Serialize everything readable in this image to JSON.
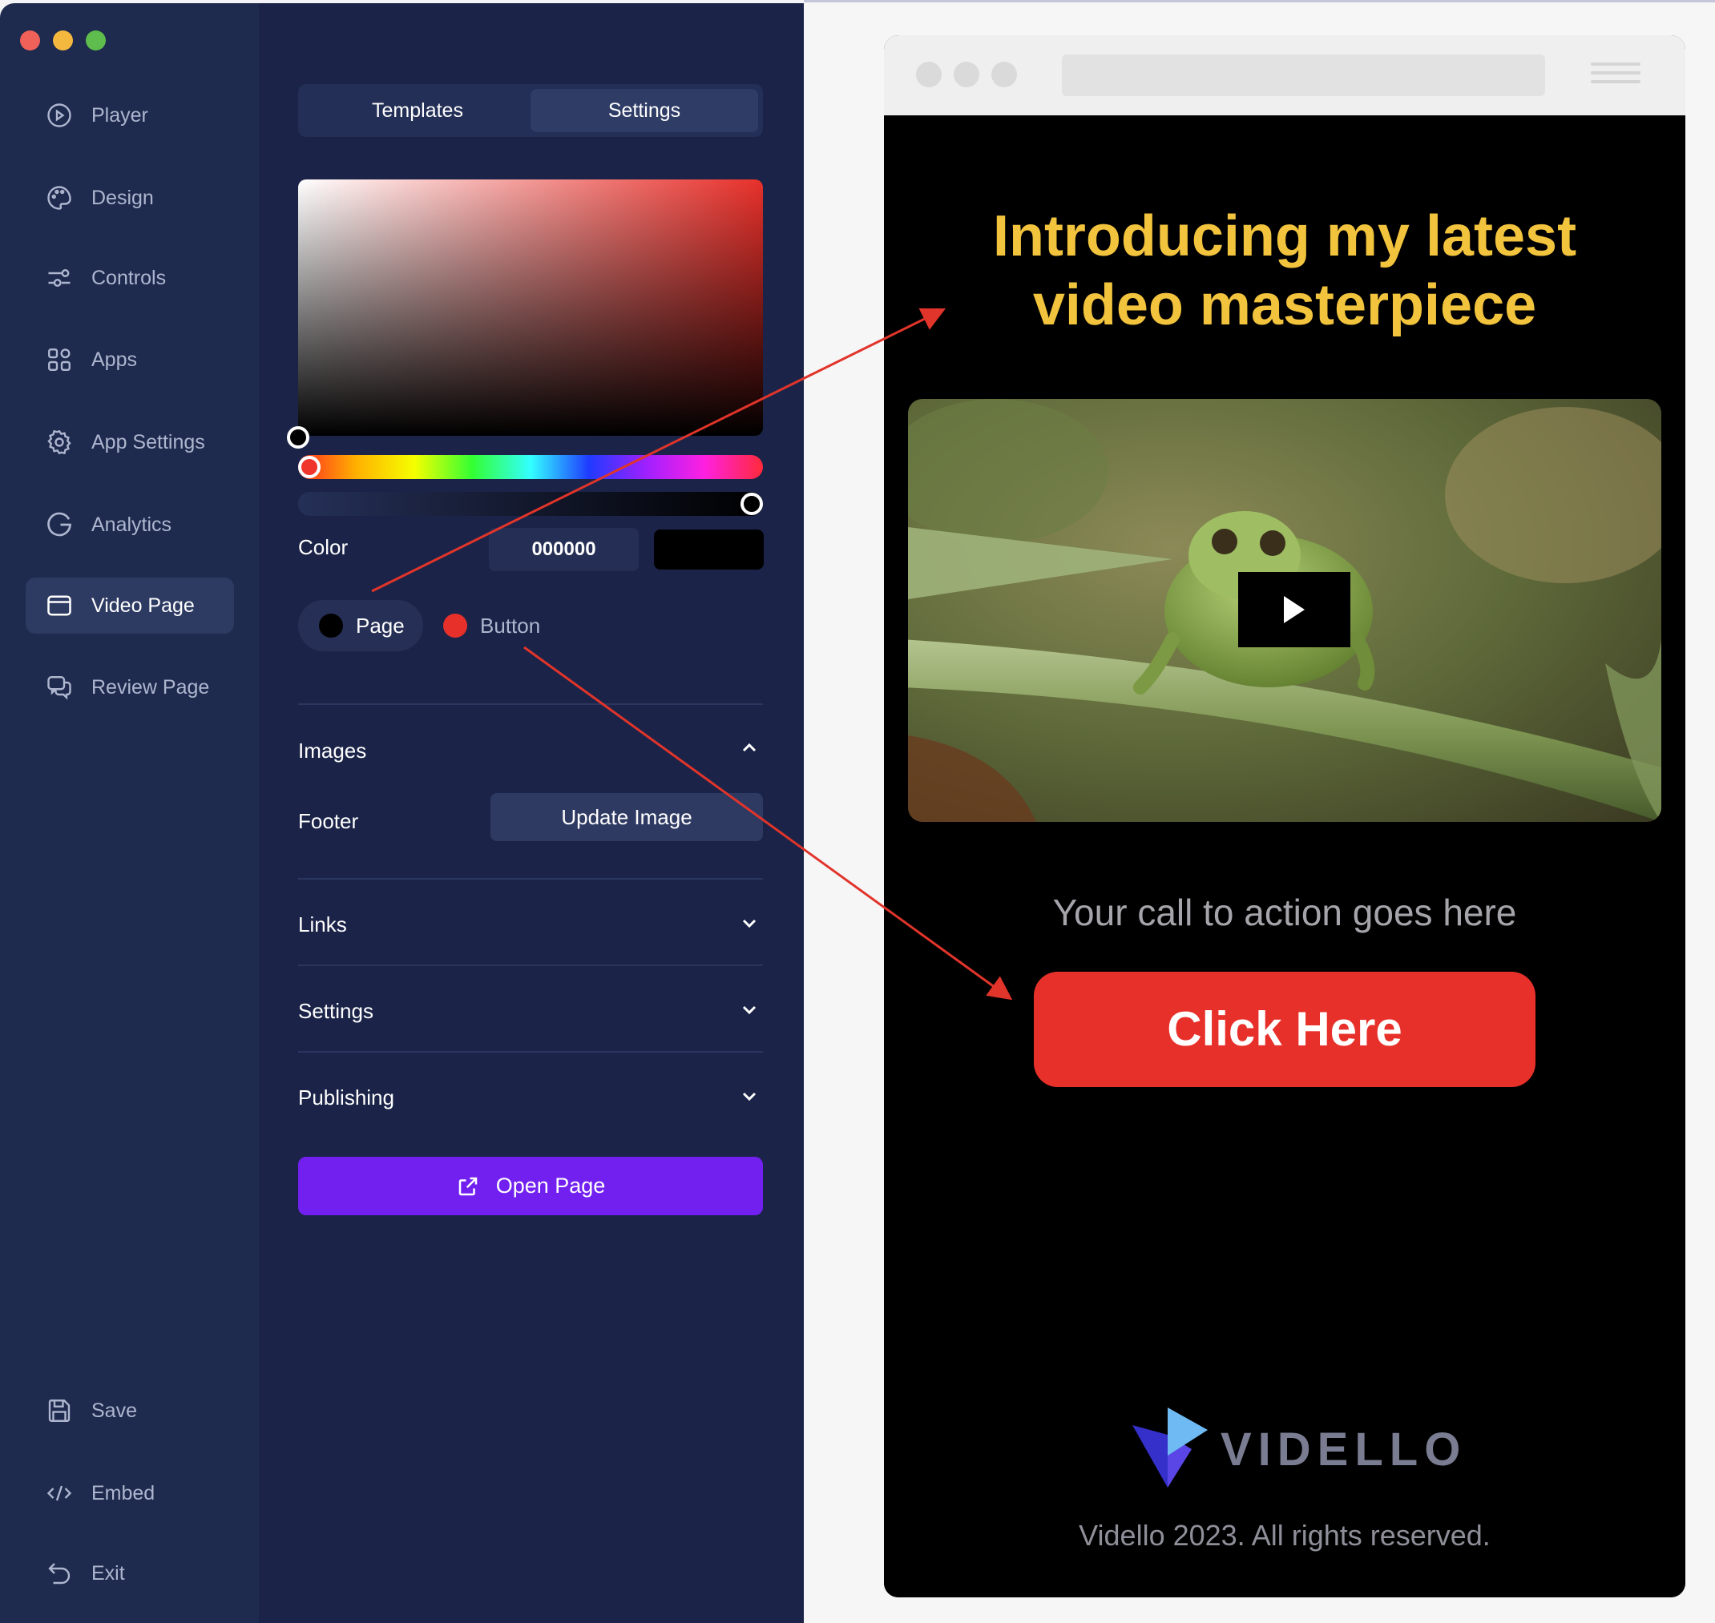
{
  "nav": {
    "items": [
      {
        "label": "Player"
      },
      {
        "label": "Design"
      },
      {
        "label": "Controls"
      },
      {
        "label": "Apps"
      },
      {
        "label": "App Settings"
      },
      {
        "label": "Analytics"
      },
      {
        "label": "Video Page"
      },
      {
        "label": "Review Page"
      }
    ],
    "bottom": [
      {
        "label": "Save"
      },
      {
        "label": "Embed"
      },
      {
        "label": "Exit"
      }
    ]
  },
  "panel": {
    "tabs": [
      "Templates",
      "Settings"
    ],
    "color_label": "Color",
    "hex_value": "000000",
    "swatch_color": "#000000",
    "targets": {
      "page": "Page",
      "button": "Button"
    },
    "sections": {
      "images": "Images",
      "footer_label": "Footer",
      "update_image": "Update Image",
      "links": "Links",
      "settings": "Settings",
      "publishing": "Publishing"
    },
    "open_page": "Open Page"
  },
  "preview": {
    "headline_line1": "Introducing my latest",
    "headline_line2": "video masterpiece",
    "cta_text": "Your call to action goes here",
    "cta_button": "Click Here",
    "logo_text": "VIDELLO",
    "copyright": "Vidello 2023. All rights reserved."
  },
  "colors": {
    "nav_bg": "#1e2a4e",
    "panel_bg": "#1b2448",
    "accent_purple": "#7220f0",
    "button_red": "#e8302a",
    "headline_yellow": "#f2c33d",
    "annotation_red": "#e1342a"
  }
}
